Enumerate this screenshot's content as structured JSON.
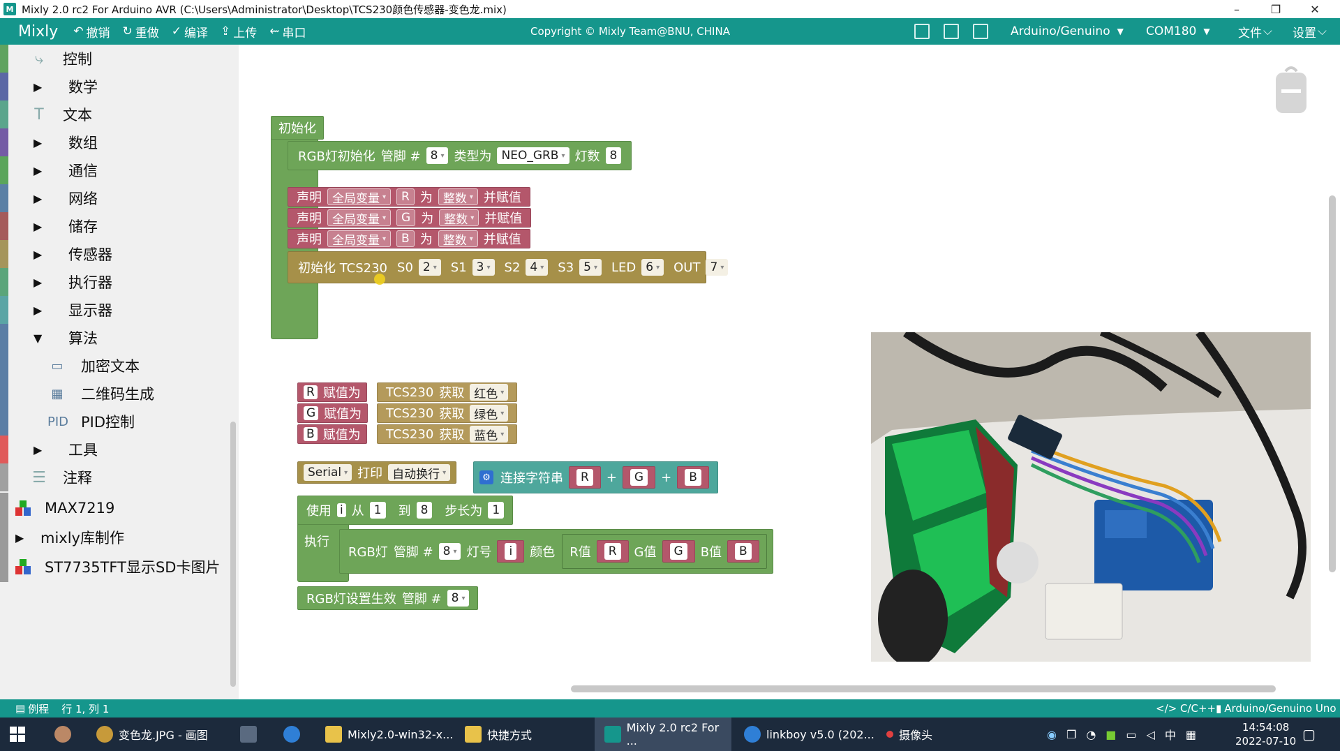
{
  "window": {
    "title": "Mixly 2.0 rc2 For Arduino AVR (C:\\Users\\Administrator\\Desktop\\TCS230颜色传感器-变色龙.mix)",
    "app_icon": "M",
    "controls": {
      "minimize": "–",
      "restore": "❐",
      "close": "✕"
    }
  },
  "appbar": {
    "brand": "Mixly",
    "toolbar": [
      {
        "label": "撤销",
        "icon": "↶"
      },
      {
        "label": "重做",
        "icon": "↻"
      },
      {
        "label": "编译",
        "icon": "✓"
      },
      {
        "label": "上传",
        "icon": "⇪"
      },
      {
        "label": "串口",
        "icon": "⇜"
      }
    ],
    "copyright": "Copyright © Mixly Team@BNU, CHINA",
    "board": "Arduino/Genuino",
    "port": "COM180",
    "file_menu": "文件",
    "settings_menu": "设置",
    "caret": "▼",
    "small_caret": "⌵"
  },
  "sidebar": {
    "categories": [
      {
        "label": "控制",
        "arrow": "",
        "icon": "⤷",
        "color": "#5fa35f"
      },
      {
        "label": "数学",
        "arrow": "▶",
        "icon": "",
        "color": "#5b67a5"
      },
      {
        "label": "文本",
        "arrow": "",
        "icon": "T",
        "color": "#5ba58c"
      },
      {
        "label": "数组",
        "arrow": "▶",
        "icon": "",
        "color": "#745ba5"
      },
      {
        "label": "通信",
        "arrow": "▶",
        "icon": "",
        "color": "#5ba55b"
      },
      {
        "label": "网络",
        "arrow": "▶",
        "icon": "",
        "color": "#5b80a5"
      },
      {
        "label": "储存",
        "arrow": "▶",
        "icon": "",
        "color": "#a55b5b"
      },
      {
        "label": "传感器",
        "arrow": "▶",
        "icon": "",
        "color": "#a5955b"
      },
      {
        "label": "执行器",
        "arrow": "▶",
        "icon": "",
        "color": "#5ba57a"
      },
      {
        "label": "显示器",
        "arrow": "▶",
        "icon": "",
        "color": "#5ba5a5"
      },
      {
        "label": "算法",
        "arrow": "▼",
        "icon": "",
        "color": "#5b7ea5"
      }
    ],
    "subitems": [
      {
        "label": "加密文本",
        "icon": "▭"
      },
      {
        "label": "二维码生成",
        "icon": "▦"
      },
      {
        "label": "PID控制",
        "icon": "PID"
      }
    ],
    "after": [
      {
        "label": "工具",
        "arrow": "▶",
        "icon": "",
        "color": "#e05a5a"
      },
      {
        "label": "注释",
        "arrow": "",
        "icon": "☰",
        "color": "#a0a0a0"
      }
    ],
    "libs": [
      {
        "label": "MAX7219",
        "arrow": ""
      },
      {
        "label": "mixly库制作",
        "arrow": "▶"
      },
      {
        "label": "ST7735TFT显示SD卡图片",
        "arrow": ""
      }
    ]
  },
  "blocks": {
    "setup": {
      "hat": "初始化",
      "rgb_init": {
        "text1": "RGB灯初始化",
        "text2": "管脚 #",
        "pin": "8",
        "text3": "类型为",
        "type": "NEO_GRB",
        "text4": "灯数",
        "count": "8"
      },
      "declares": [
        {
          "t1": "声明",
          "scope": "全局变量",
          "var": "R",
          "t2": "为",
          "vtype": "整数",
          "t3": "并赋值"
        },
        {
          "t1": "声明",
          "scope": "全局变量",
          "var": "G",
          "t2": "为",
          "vtype": "整数",
          "t3": "并赋值"
        },
        {
          "t1": "声明",
          "scope": "全局变量",
          "var": "B",
          "t2": "为",
          "vtype": "整数",
          "t3": "并赋值"
        }
      ],
      "tcs_init": {
        "text": "初始化 TCS230",
        "pins": [
          {
            "name": "S0",
            "value": "2"
          },
          {
            "name": "S1",
            "value": "3"
          },
          {
            "name": "S2",
            "value": "4"
          },
          {
            "name": "S3",
            "value": "5"
          },
          {
            "name": "LED",
            "value": "6"
          },
          {
            "name": "OUT",
            "value": "7"
          }
        ]
      }
    },
    "loop": {
      "assigns": [
        {
          "var": "R",
          "t1": "赋值为",
          "sensor": "TCS230",
          "t2": "获取",
          "color": "红色"
        },
        {
          "var": "G",
          "t1": "赋值为",
          "sensor": "TCS230",
          "t2": "获取",
          "color": "绿色"
        },
        {
          "var": "B",
          "t1": "赋值为",
          "sensor": "TCS230",
          "t2": "获取",
          "color": "蓝色"
        }
      ],
      "serial": {
        "port": "Serial",
        "t1": "打印",
        "mode": "自动换行",
        "concat": "连接字符串",
        "a": "R",
        "b": "G",
        "c": "B",
        "plus": "+"
      },
      "for": {
        "t1": "使用",
        "var": "i",
        "t2": "从",
        "from": "1",
        "t3": "到",
        "to": "8",
        "t4": "步长为",
        "step": "1",
        "do": "执行"
      },
      "setpixel": {
        "t1": "RGB灯",
        "t2": "管脚 #",
        "pin": "8",
        "t3": "灯号",
        "idx": "i",
        "t4": "颜色",
        "r_lbl": "R值",
        "r": "R",
        "g_lbl": "G值",
        "g": "G",
        "b_lbl": "B值",
        "b": "B"
      },
      "show": {
        "t1": "RGB灯设置生效",
        "t2": "管脚 #",
        "pin": "8"
      }
    }
  },
  "statusbar": {
    "examples": "例程",
    "position": "行 1, 列 1",
    "lang": "</> C/C++",
    "board": "Arduino/Genuino Uno"
  },
  "taskbar": {
    "items": [
      {
        "label": "变色龙.JPG - 画图",
        "color": "#c79a3a"
      },
      {
        "label": "Mixly2.0-win32-x...",
        "color": "#e8c24a"
      },
      {
        "label": "快捷方式",
        "color": "#e8c24a"
      },
      {
        "label": "Mixly 2.0 rc2 For ...",
        "color": "#15968c"
      },
      {
        "label": "linkboy v5.0 (202...",
        "color": "#2f7fd6"
      },
      {
        "label": "摄像头",
        "color": "#e04040"
      }
    ],
    "ime": "中",
    "time": "14:54:08",
    "date": "2022-07-10"
  }
}
